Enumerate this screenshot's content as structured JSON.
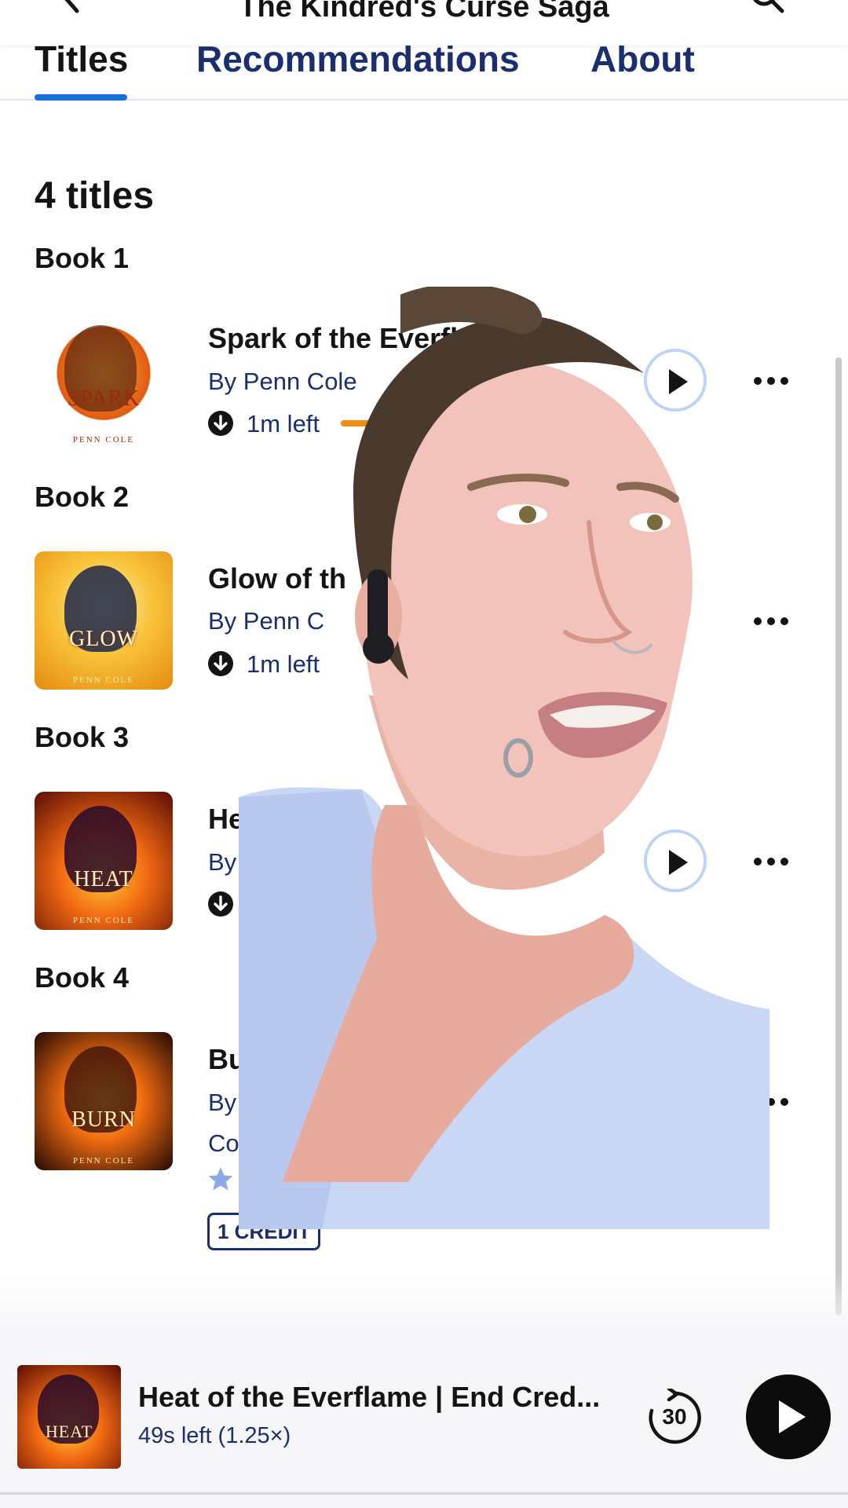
{
  "header": {
    "title": "The Kindred's Curse Saga"
  },
  "tabs": [
    {
      "label": "Titles"
    },
    {
      "label": "Recommendations"
    },
    {
      "label": "About"
    }
  ],
  "content": {
    "count": "4 titles",
    "books": [
      {
        "label": "Book 1",
        "cover_word": "SPARK",
        "cover_author": "PENN COLE",
        "title": "Spark of the Everfla",
        "author": "By Penn Cole",
        "meta": "1m left",
        "listen_progress": 0.95
      },
      {
        "label": "Book 2",
        "cover_word": "GLOW",
        "cover_author": "PENN COLE",
        "title": "Glow of th",
        "author": "By Penn C",
        "meta": "1m left"
      },
      {
        "label": "Book 3",
        "cover_word": "HEAT",
        "cover_author": "PENN COLE",
        "title": "He",
        "author": "By"
      },
      {
        "label": "Book 4",
        "cover_word": "BURN",
        "cover_author": "PENN COLE",
        "title": "Bu",
        "author": "By",
        "author_line2": "Co",
        "badge": "1 CREDIT"
      }
    ]
  },
  "player": {
    "cover_word": "HEAT",
    "title": "Heat of the Everflame | End Cred...",
    "subtitle": "49s left (1.25×)",
    "skip_seconds": "30"
  },
  "colors": {
    "accent_blue": "#1771d7",
    "navy_text": "#1b2e6f",
    "progress_orange": "#f28b12",
    "rating_star": "#8fa9e8"
  }
}
